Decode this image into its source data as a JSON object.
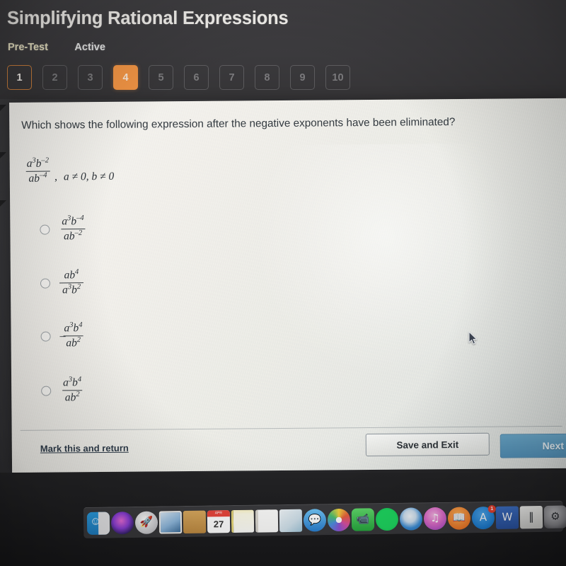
{
  "header": {
    "title": "Simplifying Rational Expressions",
    "test_label": "Pre-Test",
    "status_label": "Active",
    "accent_color": "#ef9344",
    "background_color": "#3b3a3d",
    "pager": [
      {
        "label": "1",
        "state": "completed"
      },
      {
        "label": "2",
        "state": "locked"
      },
      {
        "label": "3",
        "state": "locked"
      },
      {
        "label": "4",
        "state": "current"
      },
      {
        "label": "5",
        "state": "locked"
      },
      {
        "label": "6",
        "state": "locked"
      },
      {
        "label": "7",
        "state": "locked"
      },
      {
        "label": "8",
        "state": "locked"
      },
      {
        "label": "9",
        "state": "locked"
      },
      {
        "label": "10",
        "state": "locked"
      }
    ]
  },
  "question": {
    "prompt": "Which shows the following expression after the negative exponents have been eliminated?",
    "expression": {
      "numerator_base_1": "a",
      "numerator_exp_1": "3",
      "numerator_base_2": "b",
      "numerator_exp_2": "–2",
      "denominator_base_1": "a",
      "denominator_base_2": "b",
      "denominator_exp_2": "–4"
    },
    "condition_comma": ",",
    "condition": "a ≠ 0, b ≠ 0"
  },
  "choices": [
    {
      "id": "choice-a",
      "sign": "",
      "numerator_base_1": "a",
      "numerator_exp_1": "3",
      "numerator_base_2": "b",
      "numerator_exp_2": "–4",
      "denominator_base_1": "a",
      "denominator_base_2": "b",
      "denominator_exp_2": "–2",
      "selected": false
    },
    {
      "id": "choice-b",
      "sign": "",
      "numerator_base_1": "a",
      "numerator_exp_1": "",
      "numerator_base_2": "b",
      "numerator_exp_2": "4",
      "denominator_base_1": "a",
      "denominator_exp_1": "3",
      "denominator_base_2": "b",
      "denominator_exp_2": "2",
      "selected": false
    },
    {
      "id": "choice-c",
      "sign": "–",
      "numerator_base_1": "a",
      "numerator_exp_1": "3",
      "numerator_base_2": "b",
      "numerator_exp_2": "4",
      "denominator_base_1": "a",
      "denominator_base_2": "b",
      "denominator_exp_2": "2",
      "selected": false
    },
    {
      "id": "choice-d",
      "sign": "",
      "numerator_base_1": "a",
      "numerator_exp_1": "3",
      "numerator_base_2": "b",
      "numerator_exp_2": "4",
      "denominator_base_1": "a",
      "denominator_base_2": "b",
      "denominator_exp_2": "2",
      "selected": false
    }
  ],
  "footer": {
    "mark_return_label": "Mark this and return",
    "save_exit_label": "Save and Exit",
    "next_label": "Next",
    "next_color": "#5d9bc0"
  },
  "dock": {
    "items": [
      {
        "name": "finder-icon",
        "label": "Finder",
        "glyph": "",
        "class": "ic-finder",
        "round": false,
        "badge": ""
      },
      {
        "name": "siri-icon",
        "label": "Siri",
        "glyph": "",
        "class": "ic-siri",
        "round": true,
        "badge": ""
      },
      {
        "name": "launchpad-icon",
        "label": "Launchpad",
        "glyph": "🚀",
        "class": "ic-launch",
        "round": true,
        "badge": ""
      },
      {
        "name": "photos-booth-icon",
        "label": "Photo Booth",
        "glyph": "",
        "class": "ic-photos-a",
        "round": false,
        "badge": ""
      },
      {
        "name": "folder-icon",
        "label": "Folder",
        "glyph": "",
        "class": "ic-folder",
        "round": false,
        "badge": ""
      },
      {
        "name": "calendar-icon",
        "label": "Calendar",
        "glyph": "27",
        "class": "ic-calendar",
        "round": false,
        "badge": ""
      },
      {
        "name": "notes-icon",
        "label": "Notes",
        "glyph": "",
        "class": "ic-notes",
        "round": false,
        "badge": ""
      },
      {
        "name": "contacts-icon",
        "label": "Contacts",
        "glyph": "",
        "class": "ic-contacts",
        "round": false,
        "badge": ""
      },
      {
        "name": "preview-icon",
        "label": "Preview",
        "glyph": "",
        "class": "ic-preview",
        "round": false,
        "badge": ""
      },
      {
        "name": "messages-icon",
        "label": "Messages",
        "glyph": "💬",
        "class": "ic-messages",
        "round": true,
        "badge": ""
      },
      {
        "name": "photos-icon",
        "label": "Photos",
        "glyph": "",
        "class": "ic-photos",
        "round": true,
        "badge": ""
      },
      {
        "name": "facetime-icon",
        "label": "FaceTime",
        "glyph": "📹",
        "class": "ic-facetime",
        "round": false,
        "badge": ""
      },
      {
        "name": "spotify-icon",
        "label": "Spotify",
        "glyph": "",
        "class": "ic-spotify",
        "round": true,
        "badge": ""
      },
      {
        "name": "safari-icon",
        "label": "Safari",
        "glyph": "",
        "class": "ic-safari",
        "round": true,
        "badge": ""
      },
      {
        "name": "itunes-icon",
        "label": "iTunes",
        "glyph": "♫",
        "class": "ic-itunes",
        "round": true,
        "badge": ""
      },
      {
        "name": "books-icon",
        "label": "Books",
        "glyph": "📖",
        "class": "ic-books",
        "round": true,
        "badge": ""
      },
      {
        "name": "app-store-icon",
        "label": "App Store",
        "glyph": "A",
        "class": "ic-appstore",
        "round": true,
        "badge": "1"
      },
      {
        "name": "microsoft-word-icon",
        "label": "Word",
        "glyph": "W",
        "class": "ic-word",
        "round": false,
        "badge": ""
      },
      {
        "name": "garageband-icon",
        "label": "GarageBand",
        "glyph": "‖",
        "class": "ic-garage",
        "round": false,
        "badge": ""
      },
      {
        "name": "system-preferences-icon",
        "label": "System Preferences",
        "glyph": "⚙",
        "class": "ic-sysprefs",
        "round": false,
        "badge": ""
      }
    ]
  }
}
